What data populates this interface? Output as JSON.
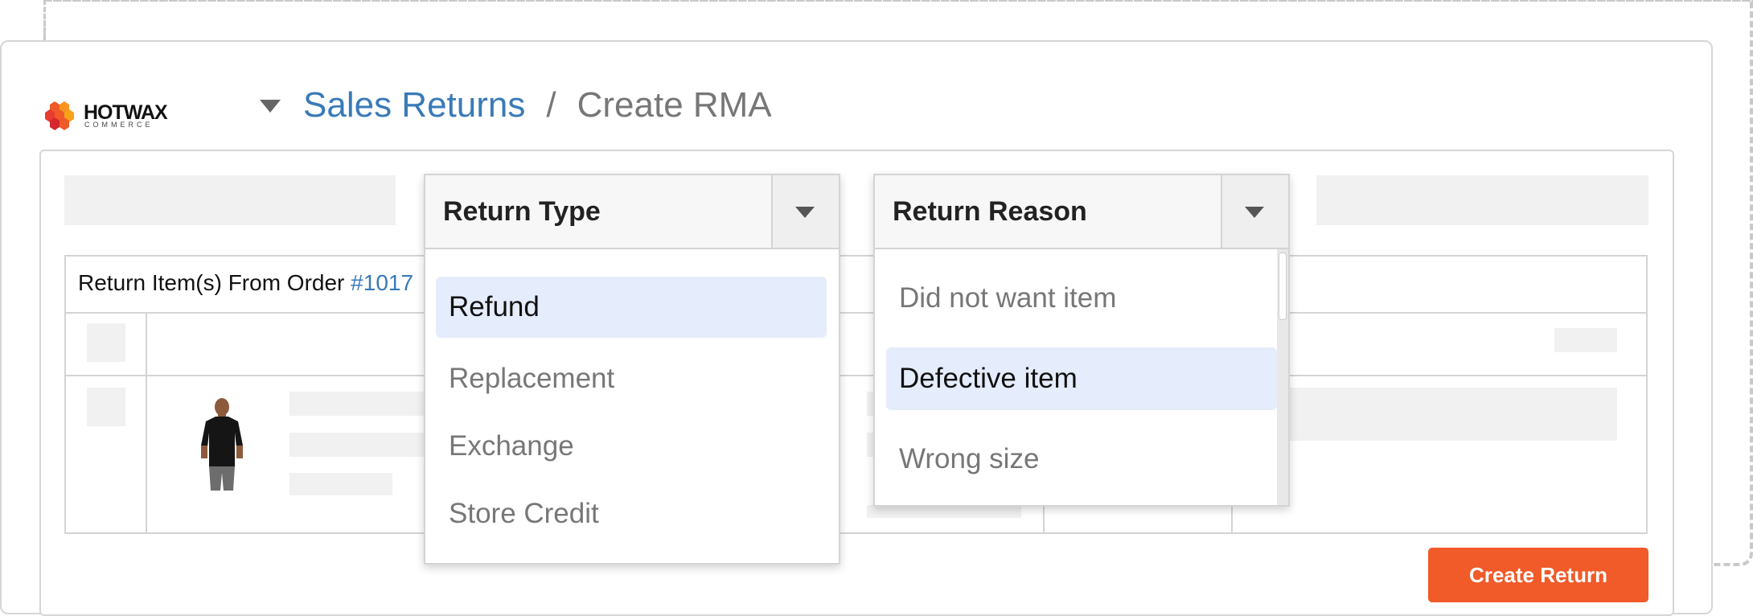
{
  "brand": {
    "name": "HOTWAX",
    "sub": "COMMERCE"
  },
  "breadcrumb": {
    "parent": "Sales Returns",
    "separator": "/",
    "current": "Create RMA"
  },
  "table": {
    "caption_prefix": "Return Item(s) From Order ",
    "order_id": "#1017"
  },
  "return_type": {
    "label": "Return Type",
    "options": [
      "Refund",
      "Replacement",
      "Exchange",
      "Store Credit"
    ],
    "selected": "Refund"
  },
  "return_reason": {
    "label": "Return Reason",
    "options": [
      "Did not want item",
      "Defective item",
      "Wrong size"
    ],
    "selected": "Defective item"
  },
  "actions": {
    "create_return": "Create Return"
  },
  "colors": {
    "accent": "#f15a29",
    "link": "#3a7ab8",
    "selected_bg": "#e5ecfb"
  }
}
